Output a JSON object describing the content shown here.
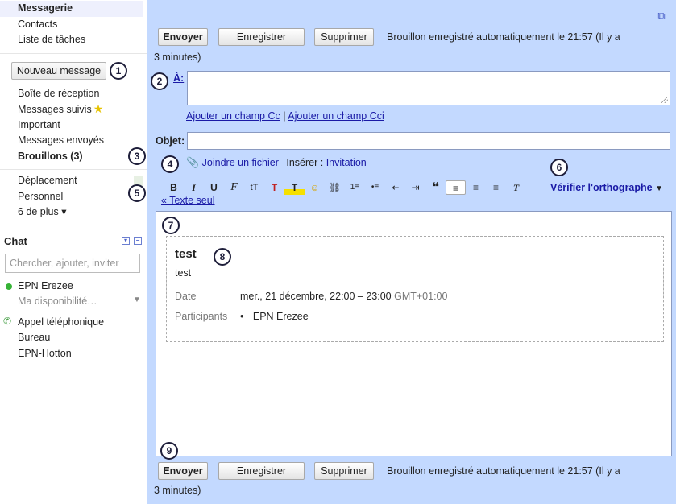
{
  "sidebar": {
    "nav_top": [
      "Messagerie",
      "Contacts",
      "Liste de tâches"
    ],
    "compose_label": "Nouveau message",
    "folders": [
      "Boîte de réception",
      "Messages suivis",
      "Important",
      "Messages envoyés",
      "Brouillons (3)"
    ],
    "labels": [
      "Déplacement",
      "Personnel"
    ],
    "more_label": "6 de plus ▾",
    "chat": {
      "title": "Chat",
      "search_placeholder": "Chercher, ajouter, inviter",
      "user_name": "EPN Erezee",
      "availability": "Ma disponibilité…",
      "call_label": "Appel téléphonique",
      "contacts": [
        "Bureau",
        "EPN-Hotton"
      ]
    }
  },
  "compose": {
    "send_label": "Envoyer",
    "save_label": "Enregistrer",
    "delete_label": "Supprimer",
    "status_line1": "Brouillon enregistré automatiquement le 21:57 (Il y a",
    "status_line2": "3 minutes)",
    "to_label": "À:",
    "add_cc": "Ajouter un champ Cc",
    "cc_sep": "|",
    "add_bcc": "Ajouter un champ Cci",
    "subject_label": "Objet:",
    "attach_label": "Joindre un fichier",
    "insert_label": "Insérer :",
    "invitation_label": "Invitation",
    "spellcheck_label": "Vérifier l'orthographe",
    "plain_text_label": "« Texte seul",
    "toolbar": {
      "bold": "B",
      "italic": "I",
      "underline": "U",
      "font": "F",
      "size": "tT",
      "text_color": "T",
      "highlight": "T",
      "emoji": "☺",
      "link": "⛓",
      "numbered_list": "1≡",
      "bullet_list": "•≡",
      "outdent": "⇤",
      "indent": "⇥",
      "quote": "❝",
      "align_left": "≡",
      "align_center": "≡",
      "align_right": "≡",
      "remove_format": "T"
    }
  },
  "event": {
    "title": "test",
    "description": "test",
    "date_key": "Date",
    "date_value": "mer., 21 décembre, 22:00 – 23:00",
    "timezone": "GMT+01:00",
    "participants_key": "Participants",
    "participant_bullet": "•",
    "participant": "EPN Erezee"
  },
  "annotations": [
    "1",
    "2",
    "3",
    "4",
    "5",
    "6",
    "7",
    "8",
    "9"
  ]
}
